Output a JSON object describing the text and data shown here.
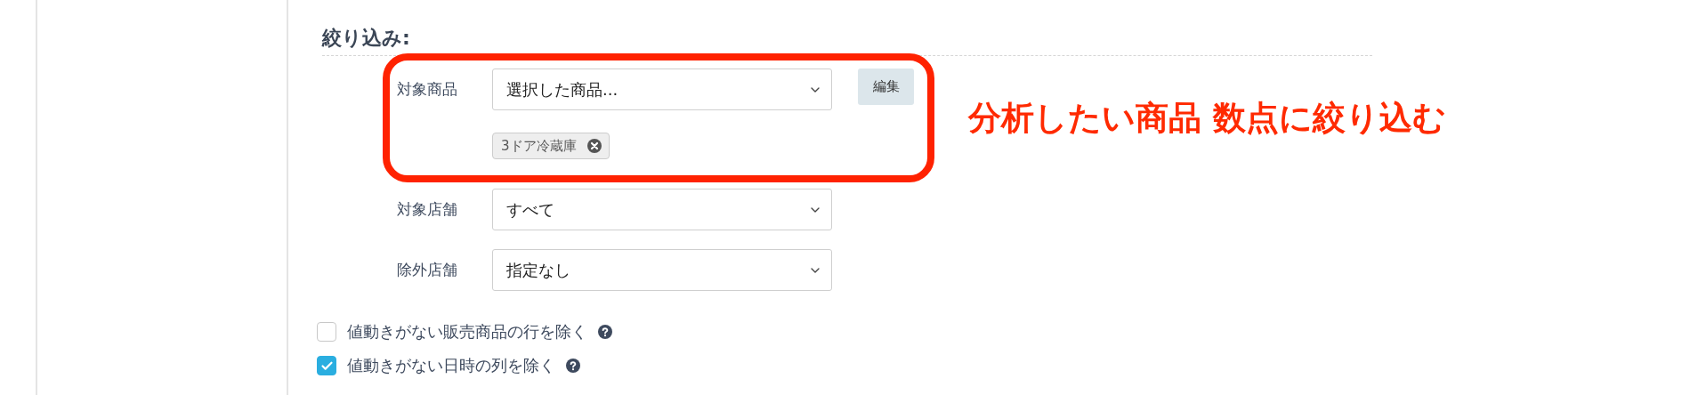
{
  "heading": "絞り込み:",
  "filters": [
    {
      "label": "対象商品",
      "value": "選択した商品...",
      "highlighted": true,
      "button": "編集",
      "tags": [
        {
          "label": "3ドア冷蔵庫"
        }
      ]
    },
    {
      "label": "対象店舗",
      "value": "すべて",
      "highlighted": false
    },
    {
      "label": "除外店舗",
      "value": "指定なし",
      "highlighted": false
    }
  ],
  "annotation": "分析したい商品 数点に絞り込む",
  "options": [
    {
      "label": "値動きがない販売商品の行を除く",
      "checked": false
    },
    {
      "label": "値動きがない日時の列を除く",
      "checked": true
    }
  ]
}
